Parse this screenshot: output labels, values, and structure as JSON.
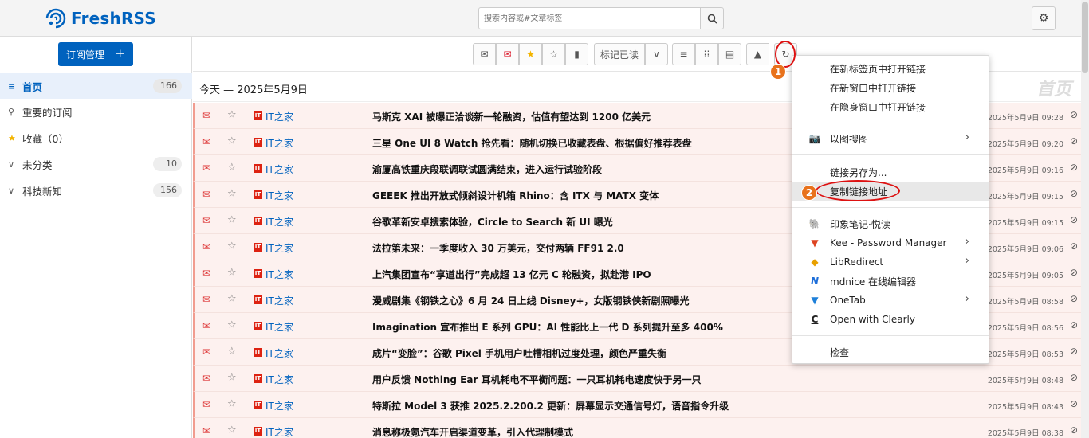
{
  "app": {
    "name": "FreshRSS",
    "accent": "#0062be"
  },
  "header": {
    "search_placeholder": "搜索内容或#文章标签",
    "settings_icon": "gear-icon"
  },
  "sidebar": {
    "subscribe_label": "订阅管理",
    "subscribe_plus": "+",
    "items": [
      {
        "label": "首页",
        "count": "166",
        "icon": "≡"
      },
      {
        "label": "重要的订阅",
        "count": "",
        "icon": "⚲"
      },
      {
        "label": "收藏（0）",
        "count": "",
        "icon": "★"
      },
      {
        "label": "未分类",
        "count": "10",
        "icon": "∨"
      },
      {
        "label": "科技新知",
        "count": "156",
        "icon": "∨"
      }
    ]
  },
  "toolbar": {
    "mark_read_label": "标记已读",
    "buttons": [
      "unread-filter",
      "read-filter",
      "starred-filter",
      "unstarred-filter",
      "bookmark",
      "mark-read-dropdown",
      "list-view",
      "grid-view",
      "reader-view",
      "scroll-top",
      "refresh"
    ]
  },
  "main": {
    "day_label": "今天 — 2025年5月9日",
    "watermark": "首页"
  },
  "articles": [
    {
      "feed": "IT之家",
      "title": "马斯克 XAI 被曝正洽谈新一轮融资，估值有望达到 1200 亿美元",
      "date": "2025年5月9日 09:28"
    },
    {
      "feed": "IT之家",
      "title": "三星 One UI 8 Watch 抢先看：随机切换已收藏表盘、根据偏好推荐表盘",
      "date": "2025年5月9日 09:20"
    },
    {
      "feed": "IT之家",
      "title": "渝厦高铁重庆段联调联试圆满结束，进入运行试验阶段",
      "date": "2025年5月9日 09:16"
    },
    {
      "feed": "IT之家",
      "title": "GEEEK 推出开放式倾斜设计机箱 Rhino：含 ITX 与 MATX 变体",
      "date": "2025年5月9日 09:15"
    },
    {
      "feed": "IT之家",
      "title": "谷歌革新安卓搜索体验，Circle to Search 新 UI 曝光",
      "date": "2025年5月9日 09:15"
    },
    {
      "feed": "IT之家",
      "title": "法拉第未来：一季度收入 30 万美元，交付两辆 FF91 2.0",
      "date": "2025年5月9日 09:06"
    },
    {
      "feed": "IT之家",
      "title": "上汽集团宣布“享道出行”完成超 13 亿元 C 轮融资，拟赴港 IPO",
      "date": "2025年5月9日 09:05"
    },
    {
      "feed": "IT之家",
      "title": "漫威剧集《钢铁之心》6 月 24 日上线 Disney+，女版钢铁侠新剧照曝光",
      "date": "2025年5月9日 08:58"
    },
    {
      "feed": "IT之家",
      "title": "Imagination 宣布推出 E 系列 GPU：AI 性能比上一代 D 系列提升至多 400%",
      "date": "2025年5月9日 08:56"
    },
    {
      "feed": "IT之家",
      "title": "成片“变脸”：谷歌 Pixel 手机用户吐槽相机过度处理，颜色严重失衡",
      "date": "2025年5月9日 08:53"
    },
    {
      "feed": "IT之家",
      "title": "用户反馈 Nothing Ear 耳机耗电不平衡问题：一只耳机耗电速度快于另一只",
      "date": "2025年5月9日 08:48"
    },
    {
      "feed": "IT之家",
      "title": "特斯拉 Model 3 获推 2025.2.200.2 更新：屏幕显示交通信号灯，语音指令升级",
      "date": "2025年5月9日 08:43"
    },
    {
      "feed": "IT之家",
      "title": "消息称极氪汽车开启渠道变革，引入代理制模式",
      "date": "2025年5月9日 08:38"
    }
  ],
  "feed_icon_text": "IT",
  "context_menu": {
    "items": [
      {
        "label": "在新标签页中打开链接"
      },
      {
        "label": "在新窗口中打开链接"
      },
      {
        "label": "在隐身窗口中打开链接"
      },
      {
        "label": "以图搜图"
      },
      {
        "label": "链接另存为..."
      },
      {
        "label": "复制链接地址"
      },
      {
        "label": "印象笔记·悦读"
      },
      {
        "label": "Kee - Password Manager"
      },
      {
        "label": "LibRedirect"
      },
      {
        "label": "mdnice 在线编辑器"
      },
      {
        "label": "OneTab"
      },
      {
        "label": "Open with Clearly"
      },
      {
        "label": "检查"
      }
    ]
  },
  "annotations": {
    "step1": "1",
    "step2": "2"
  }
}
